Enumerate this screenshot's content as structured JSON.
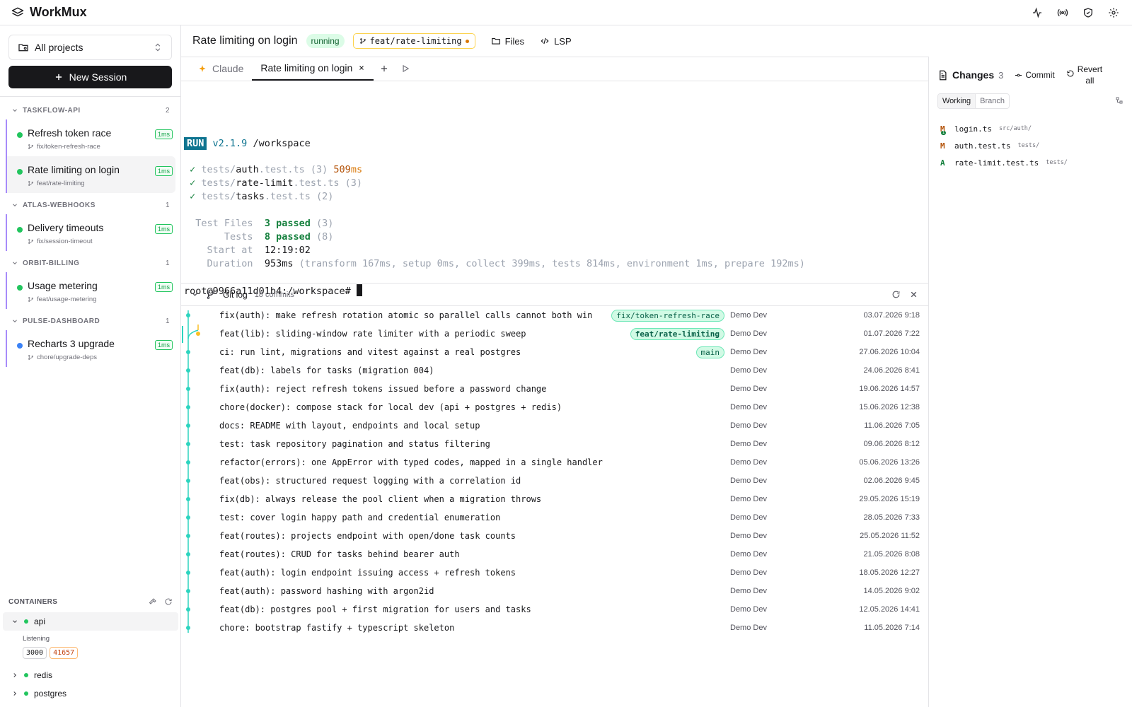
{
  "app": {
    "name": "WorkMux"
  },
  "sidebar": {
    "project_select": "All projects",
    "new_session": "New Session",
    "groups": [
      {
        "name": "TASKFLOW-API",
        "count": "2",
        "sessions": [
          {
            "title": "Refresh token race",
            "branch": "fix/token-refresh-race",
            "badge": "1ms",
            "status": "green"
          },
          {
            "title": "Rate limiting on login",
            "branch": "feat/rate-limiting",
            "badge": "1ms",
            "status": "green",
            "active": true
          }
        ]
      },
      {
        "name": "ATLAS-WEBHOOKS",
        "count": "1",
        "sessions": [
          {
            "title": "Delivery timeouts",
            "branch": "fix/session-timeout",
            "badge": "1ms",
            "status": "green"
          }
        ]
      },
      {
        "name": "ORBIT-BILLING",
        "count": "1",
        "sessions": [
          {
            "title": "Usage metering",
            "branch": "feat/usage-metering",
            "badge": "1ms",
            "status": "green"
          }
        ]
      },
      {
        "name": "PULSE-DASHBOARD",
        "count": "1",
        "sessions": [
          {
            "title": "Recharts 3 upgrade",
            "branch": "chore/upgrade-deps",
            "badge": "1ms",
            "status": "blue"
          }
        ]
      }
    ],
    "containers": {
      "title": "CONTAINERS",
      "items": [
        {
          "name": "api",
          "open": true,
          "status_text": "Listening",
          "ports": [
            "3000",
            "41657"
          ]
        },
        {
          "name": "redis",
          "open": false
        },
        {
          "name": "postgres",
          "open": false
        }
      ]
    }
  },
  "main": {
    "title": "Rate limiting on login",
    "status": "running",
    "branch": "feat/rate-limiting",
    "files_label": "Files",
    "lsp_label": "LSP",
    "tabs": [
      {
        "label": "Claude",
        "active": false
      },
      {
        "label": "Rate limiting on login",
        "active": true
      }
    ]
  },
  "terminal": {
    "run_badge": "RUN",
    "version": "v2.1.9",
    "cwd": "/workspace",
    "tests": [
      {
        "dir": "tests/",
        "name": "auth",
        "ext": ".test.ts",
        "count": "(3)",
        "time": "509",
        "unit": "ms"
      },
      {
        "dir": "tests/",
        "name": "rate-limit",
        "ext": ".test.ts",
        "count": "(3)",
        "time": "",
        "unit": ""
      },
      {
        "dir": "tests/",
        "name": "tasks",
        "ext": ".test.ts",
        "count": "(2)",
        "time": "",
        "unit": ""
      }
    ],
    "summary": {
      "test_files_label": "Test Files",
      "test_files_value": "3 passed",
      "test_files_count": "(3)",
      "tests_label": "Tests",
      "tests_value": "8 passed",
      "tests_count": "(8)",
      "start_label": "Start at",
      "start_value": "12:19:02",
      "duration_label": "Duration",
      "duration_value": "953ms",
      "duration_detail": "(transform 167ms, setup 0ms, collect 399ms, tests 814ms, environment 1ms, prepare 192ms)"
    },
    "prompt": "root@9966a11d01b4:/workspace#"
  },
  "gitlog": {
    "title": "Git log",
    "count": "18 commits",
    "commits": [
      {
        "msg": "fix(auth): make refresh rotation atomic so parallel calls cannot both win",
        "ref": "fix/token-refresh-race",
        "author": "Demo Dev",
        "date": "03.07.2026 9:18"
      },
      {
        "msg": "feat(lib): sliding-window rate limiter with a periodic sweep",
        "ref": "feat/rate-limiting",
        "author": "Demo Dev",
        "date": "01.07.2026 7:22"
      },
      {
        "msg": "ci: run lint, migrations and vitest against a real postgres",
        "ref": "main",
        "author": "Demo Dev",
        "date": "27.06.2026 10:04"
      },
      {
        "msg": "feat(db): labels for tasks (migration 004)",
        "ref": "",
        "author": "Demo Dev",
        "date": "24.06.2026 8:41"
      },
      {
        "msg": "fix(auth): reject refresh tokens issued before a password change",
        "ref": "",
        "author": "Demo Dev",
        "date": "19.06.2026 14:57"
      },
      {
        "msg": "chore(docker): compose stack for local dev (api + postgres + redis)",
        "ref": "",
        "author": "Demo Dev",
        "date": "15.06.2026 12:38"
      },
      {
        "msg": "docs: README with layout, endpoints and local setup",
        "ref": "",
        "author": "Demo Dev",
        "date": "11.06.2026 7:05"
      },
      {
        "msg": "test: task repository pagination and status filtering",
        "ref": "",
        "author": "Demo Dev",
        "date": "09.06.2026 8:12"
      },
      {
        "msg": "refactor(errors): one AppError with typed codes, mapped in a single handler",
        "ref": "",
        "author": "Demo Dev",
        "date": "05.06.2026 13:26"
      },
      {
        "msg": "feat(obs): structured request logging with a correlation id",
        "ref": "",
        "author": "Demo Dev",
        "date": "02.06.2026 9:45"
      },
      {
        "msg": "fix(db): always release the pool client when a migration throws",
        "ref": "",
        "author": "Demo Dev",
        "date": "29.05.2026 15:19"
      },
      {
        "msg": "test: cover login happy path and credential enumeration",
        "ref": "",
        "author": "Demo Dev",
        "date": "28.05.2026 7:33"
      },
      {
        "msg": "feat(routes): projects endpoint with open/done task counts",
        "ref": "",
        "author": "Demo Dev",
        "date": "25.05.2026 11:52"
      },
      {
        "msg": "feat(routes): CRUD for tasks behind bearer auth",
        "ref": "",
        "author": "Demo Dev",
        "date": "21.05.2026 8:08"
      },
      {
        "msg": "feat(auth): login endpoint issuing access + refresh tokens",
        "ref": "",
        "author": "Demo Dev",
        "date": "18.05.2026 12:27"
      },
      {
        "msg": "feat(auth): password hashing with argon2id",
        "ref": "",
        "author": "Demo Dev",
        "date": "14.05.2026 9:02"
      },
      {
        "msg": "feat(db): postgres pool + first migration for users and tasks",
        "ref": "",
        "author": "Demo Dev",
        "date": "12.05.2026 14:41"
      },
      {
        "msg": "chore: bootstrap fastify + typescript skeleton",
        "ref": "",
        "author": "Demo Dev",
        "date": "11.05.2026 7:14"
      }
    ]
  },
  "changes": {
    "title": "Changes",
    "count": "3",
    "commit_label": "Commit",
    "revert_label_1": "Revert",
    "revert_label_2": "all",
    "seg_working": "Working",
    "seg_branch": "Branch",
    "files": [
      {
        "status": "M",
        "name": "login.ts",
        "path": "src/auth/",
        "sub": "1"
      },
      {
        "status": "M",
        "name": "auth.test.ts",
        "path": "tests/",
        "sub": ""
      },
      {
        "status": "A",
        "name": "rate-limit.test.ts",
        "path": "tests/",
        "sub": ""
      }
    ]
  },
  "colors": {
    "accent": "#18181b",
    "green": "#22c55e",
    "branch_purple": "#a78bfa",
    "graph_teal": "#2dd4bf",
    "graph_amber": "#fbbf24"
  }
}
